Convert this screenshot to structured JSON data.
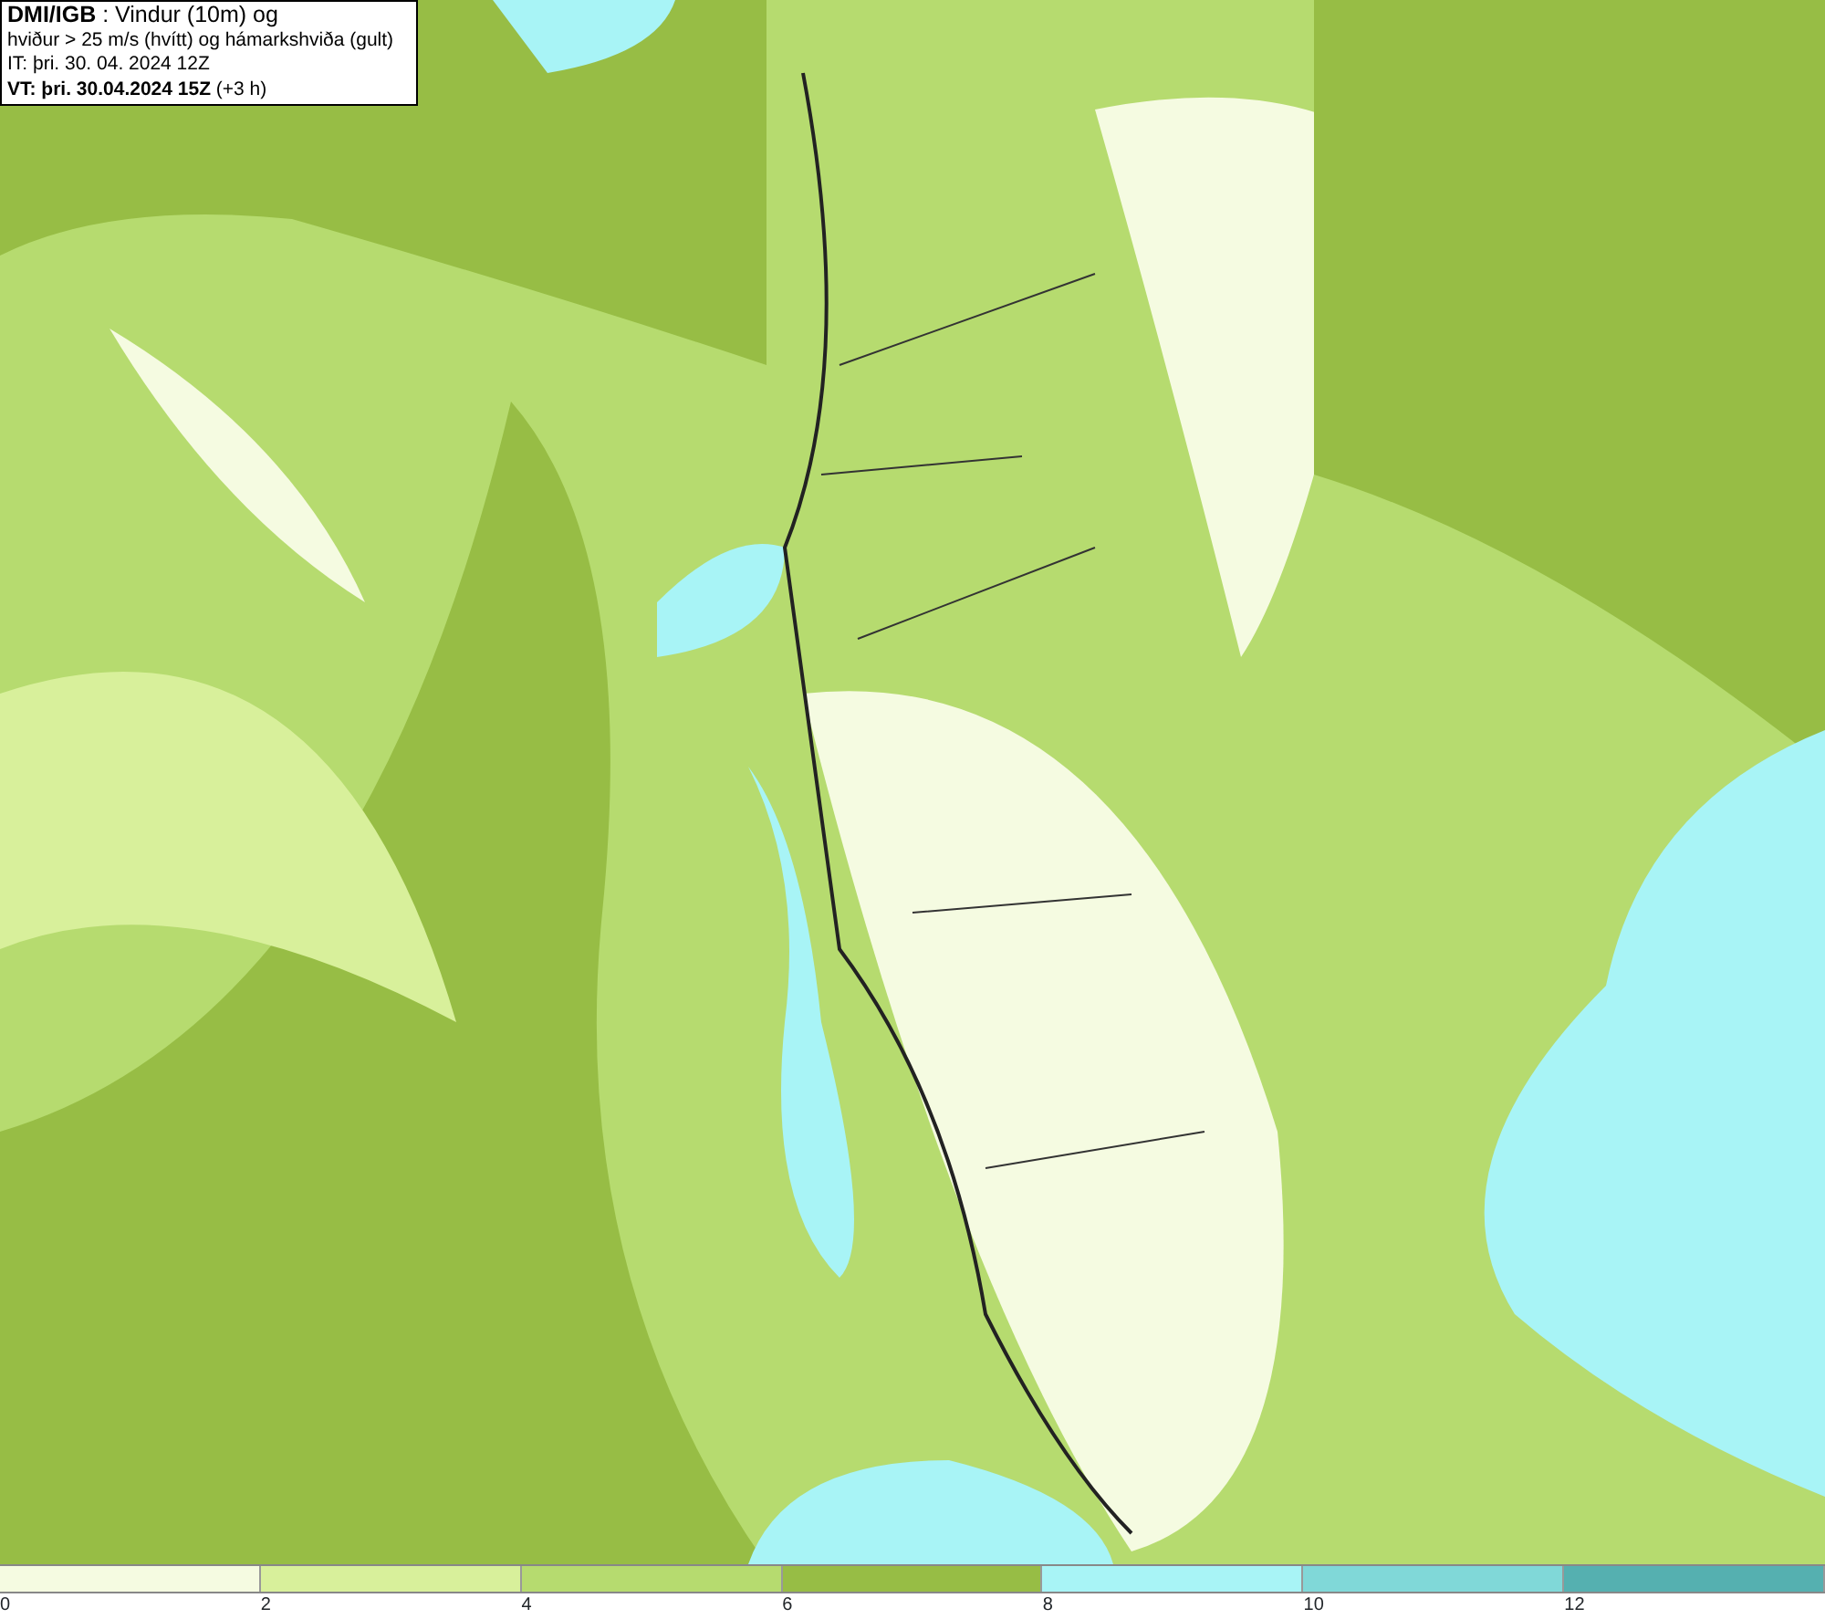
{
  "header": {
    "lines": [
      "**DMI/IGB** : Vindur (10m) og",
      "hviður > 25 m/s (hvítt) og hámarkshviða (gult)",
      "IT: þri. 30. 04. 2024 12Z",
      "**VT: þri. 30.04.2024 15Z** (+3 h)"
    ]
  },
  "legend": {
    "bins": [
      {
        "color": "#f5fbe1"
      },
      {
        "color": "#d8f09b"
      },
      {
        "color": "#b6db6f"
      },
      {
        "color": "#97bd45"
      },
      {
        "color": "#a8f4f6"
      },
      {
        "color": "#80d8d8"
      },
      {
        "color": "#55b0b0"
      }
    ],
    "ticks": [
      "0",
      "2",
      "4",
      "6",
      "8",
      "10",
      "12"
    ]
  }
}
